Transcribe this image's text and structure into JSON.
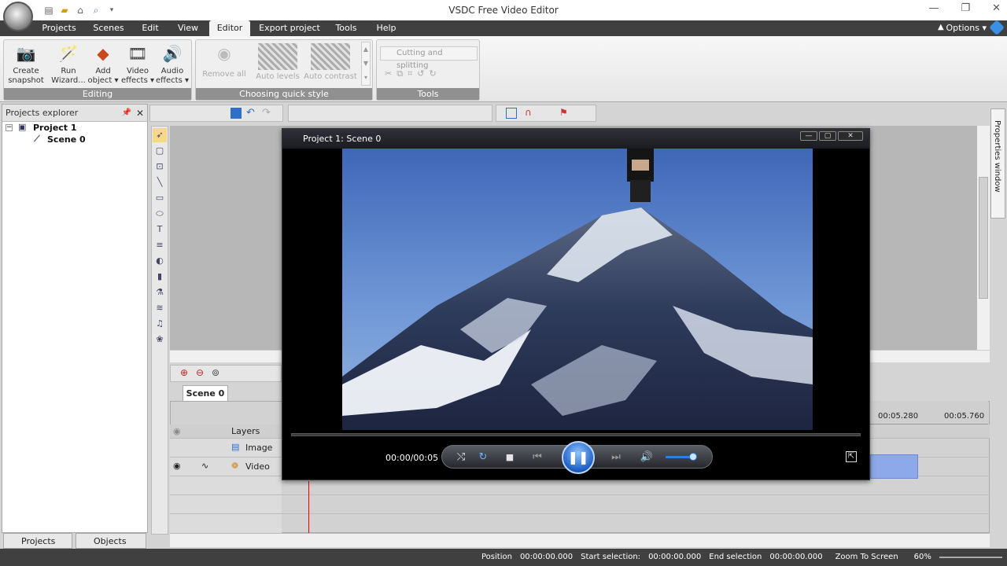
{
  "window": {
    "title": "VSDC Free Video Editor",
    "minimize": "—",
    "restore": "❐",
    "close": "✕"
  },
  "menu": {
    "items": [
      {
        "label": "Projects"
      },
      {
        "label": "Scenes"
      },
      {
        "label": "Edit"
      },
      {
        "label": "View"
      },
      {
        "label": "Editor"
      },
      {
        "label": "Export project"
      },
      {
        "label": "Tools"
      },
      {
        "label": "Help"
      }
    ],
    "active": "Editor",
    "options": "Options"
  },
  "ribbon": {
    "editing": {
      "label": "Editing",
      "buttons": [
        {
          "label": "Create",
          "label2": "snapshot"
        },
        {
          "label": "Run",
          "label2": "Wizard..."
        },
        {
          "label": "Add",
          "label2": "object"
        },
        {
          "label": "Video",
          "label2": "effects"
        },
        {
          "label": "Audio",
          "label2": "effects"
        }
      ]
    },
    "quick_style": {
      "label": "Choosing quick style",
      "buttons": [
        {
          "label": "Remove all"
        },
        {
          "label": "Auto levels"
        },
        {
          "label": "Auto contrast"
        }
      ]
    },
    "tools": {
      "label": "Tools",
      "cutting": "Cutting and splitting"
    }
  },
  "projects_explorer": {
    "title": "Projects explorer",
    "project": "Project 1",
    "scene": "Scene 0"
  },
  "bottom_tabs": [
    {
      "label": "Projects ex..."
    },
    {
      "label": "Objects ex..."
    }
  ],
  "properties_window": "Properties window",
  "timeline": {
    "scene_tab": "Scene 0",
    "layers_header": "Layers",
    "layers": [
      {
        "name": "Image"
      },
      {
        "name": "Video"
      }
    ],
    "ruler": [
      "00:05.280",
      "00:05.760"
    ]
  },
  "preview": {
    "title": "Project 1: Scene 0",
    "timecode": "00:00/00:05",
    "volume": 0.8
  },
  "status": {
    "position_label": "Position",
    "position": "00:00:00.000",
    "start_label": "Start selection:",
    "start": "00:00:00.000",
    "end_label": "End selection",
    "end": "00:00:00.000",
    "zoom_label": "Zoom To Screen",
    "zoom": "60%"
  },
  "colors": {
    "menu_bg": "#404040",
    "accent": "#2e7ee0",
    "clip": "#8ea9ea"
  }
}
